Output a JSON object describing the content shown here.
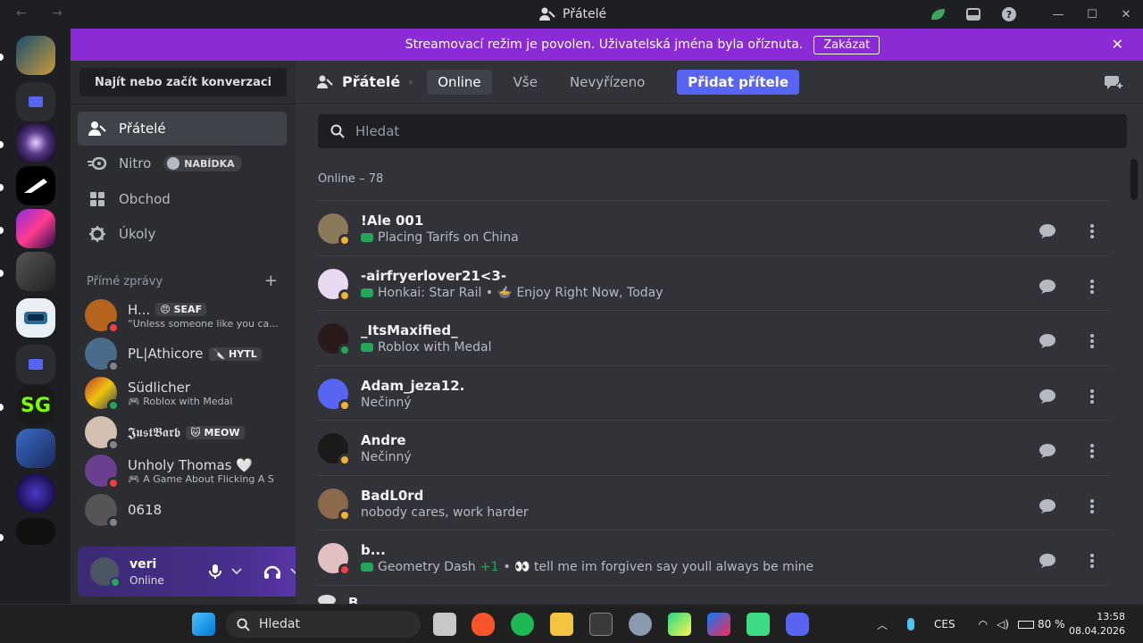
{
  "window": {
    "title": "Přátelé",
    "nav_arrows": "← →",
    "controls": [
      "—",
      "☐",
      "✕"
    ]
  },
  "banner": {
    "text": "Streamovací režim je povolen. Uživatelská jména byla oříznuta.",
    "button": "Zakázat",
    "close": "✕"
  },
  "sidebar": {
    "find_placeholder": "Najít nebo začít konverzaci",
    "nav": [
      {
        "label": "Přátelé",
        "active": true
      },
      {
        "label": "Nitro",
        "badge": "NABÍDKA"
      },
      {
        "label": "Obchod"
      },
      {
        "label": "Úkoly"
      }
    ],
    "dm_header": "Přímé zprávy",
    "dm_add": "+",
    "dms": [
      {
        "name": "H...",
        "tag": "😠 SEAF",
        "sub": "“Unless someone like you ca...",
        "status": "dnd",
        "color": "#b5651d"
      },
      {
        "name": "PL|Athicore",
        "tag": "🔪 HYTL",
        "sub": "",
        "status": "off",
        "color": "#4b6b8a"
      },
      {
        "name": "Südlicher",
        "tag": "",
        "sub": "🎮 Roblox with Medal",
        "status": "on",
        "color": "#c0392b"
      },
      {
        "name": "𝕵𝖚𝖘𝖙𝕭𝖆𝖗𝖇",
        "tag": "🐱 MEOW",
        "sub": "",
        "status": "off",
        "color": "#d4c0b0"
      },
      {
        "name": "Unholy Thomas 🤍",
        "tag": "",
        "sub": "🎮 A Game About Flicking A S",
        "status": "dnd",
        "color": "#6a3f8f"
      },
      {
        "name": "0618",
        "tag": "",
        "sub": "",
        "status": "off",
        "color": "#555"
      }
    ],
    "user": {
      "name": "veri",
      "status": "Online"
    }
  },
  "main": {
    "header_title": "Přátelé",
    "tabs": [
      "Online",
      "Vše",
      "Nevyřízeno"
    ],
    "add_friend": "Přidat přítele",
    "search_placeholder": "Hledat",
    "online_count": "Online – 78",
    "friends": [
      {
        "name": "!Ale 001",
        "activity": "Placing Tarifs on China",
        "game": true,
        "status": "idle",
        "color": "#8a7a5a"
      },
      {
        "name": "-airfryerlover21<3-",
        "activity": "Honkai: Star Rail • 🍲 Enjoy Right Now, Today",
        "game": true,
        "status": "idle",
        "color": "#e8d8f0"
      },
      {
        "name": "_ItsMaxified_",
        "activity": "Roblox with Medal",
        "game": true,
        "status": "on",
        "color": "#2a1a1a"
      },
      {
        "name": "Adam_jeza12.",
        "activity": "Nečinný",
        "game": false,
        "status": "idle",
        "color": "#5865f2"
      },
      {
        "name": "Andre",
        "activity": "Nečinný",
        "game": false,
        "status": "idle",
        "color": "#1a1a1a"
      },
      {
        "name": "BadL0rd",
        "activity": "nobody cares, work harder",
        "game": false,
        "status": "idle",
        "color": "#8a6a4a"
      },
      {
        "name": "b...",
        "activity": "Geometry Dash",
        "plus": "+1",
        "activity2": "• 👀 tell me im forgiven say youll always be mine",
        "game": true,
        "status": "dnd",
        "color": "#e0c0c0"
      }
    ],
    "partial_name": "B..."
  },
  "taskbar": {
    "search": "Hledat",
    "lang": "CES",
    "battery": "80 %",
    "time": "13:58",
    "date": "08.04.2026"
  },
  "colors": {
    "accent": "#5865f2",
    "banner": "#8b2bd6",
    "online": "#23a55a",
    "idle": "#f0b232",
    "dnd": "#f23f43"
  }
}
